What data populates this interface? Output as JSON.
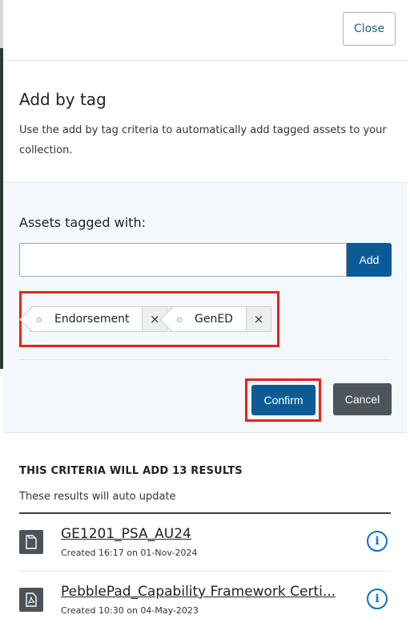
{
  "header": {
    "close_label": "Close"
  },
  "intro": {
    "title": "Add by tag",
    "description": "Use the add by tag criteria to automatically add tagged assets to your collection."
  },
  "criteria": {
    "label": "Assets tagged with:",
    "input_value": "",
    "add_label": "Add",
    "tags": [
      {
        "label": "Endorsement",
        "remove": "×"
      },
      {
        "label": "GenED",
        "remove": "×"
      }
    ],
    "confirm_label": "Confirm",
    "cancel_label": "Cancel",
    "highlight_color": "#e8231f"
  },
  "results": {
    "heading": "THIS CRITERIA WILL ADD 13 RESULTS",
    "subheading": "These results will auto update",
    "items": [
      {
        "icon": "document-icon",
        "title": "GE1201_PSA_AU24",
        "meta": "Created 16:17 on 01-Nov-2024",
        "info": "i"
      },
      {
        "icon": "pdf-icon",
        "title": "PebblePad_Capability Framework Certi...",
        "meta": "Created 10:30 on 04-May-2023",
        "info": "i"
      }
    ]
  },
  "colors": {
    "primary": "#0b5c96",
    "secondary": "#4d545a",
    "criteria_bg": "#f3f8fa"
  }
}
